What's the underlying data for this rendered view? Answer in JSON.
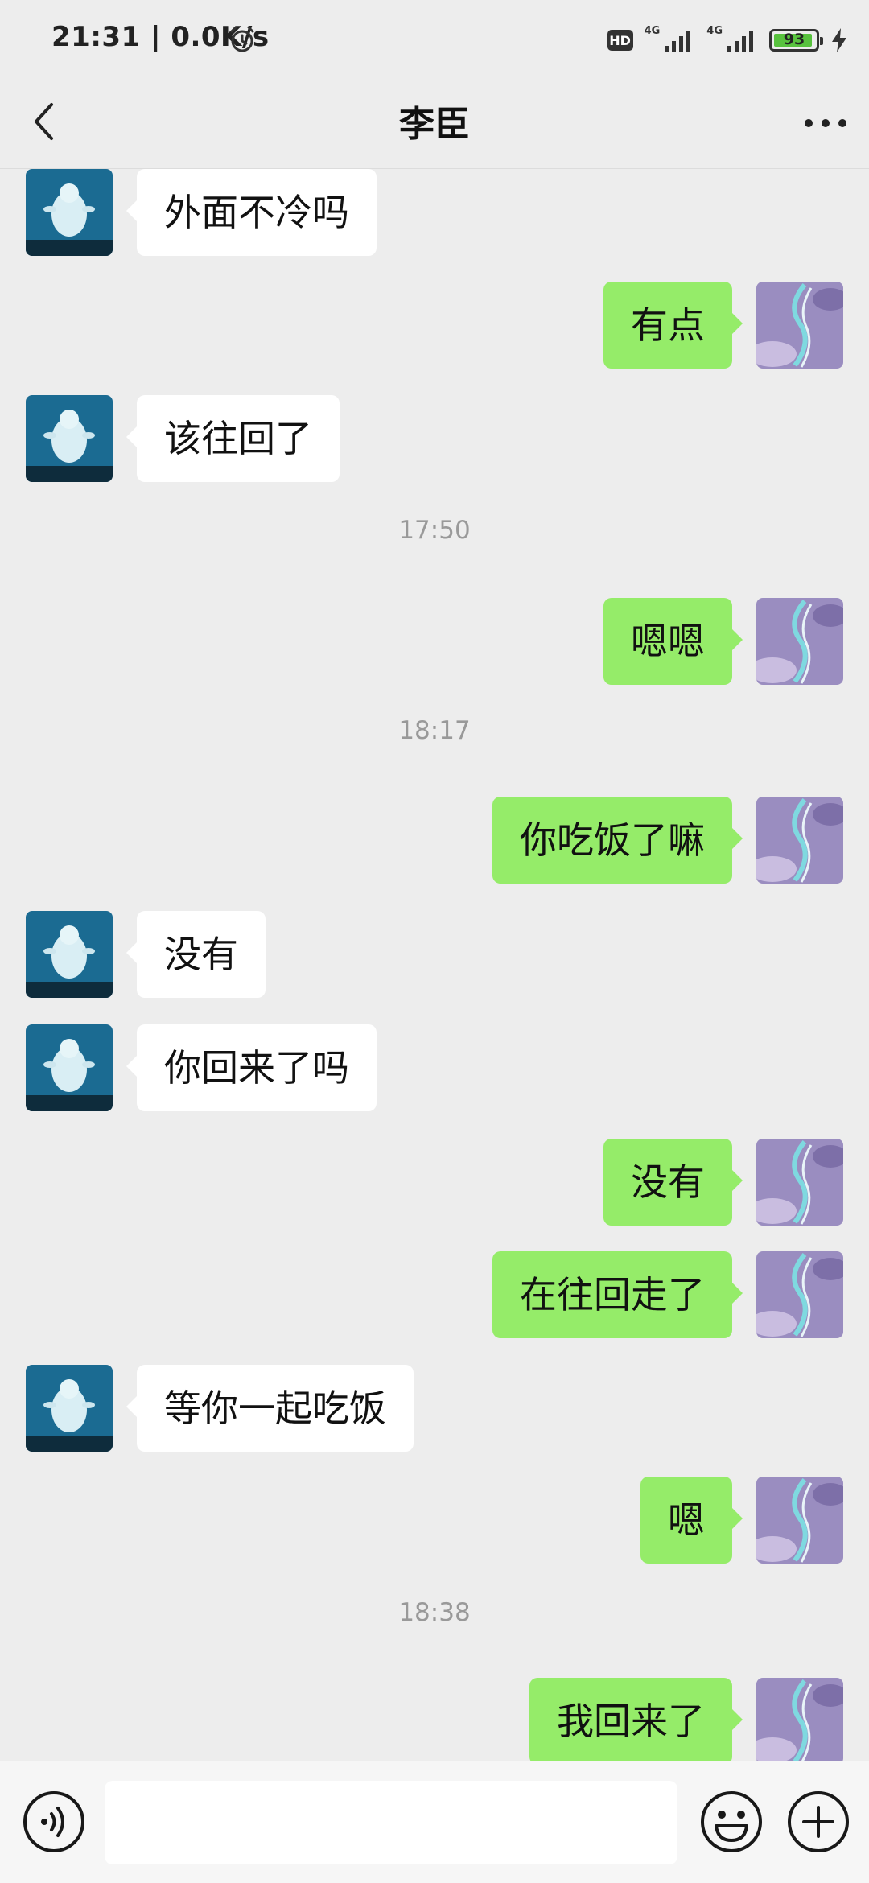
{
  "status_bar": {
    "time": "21:31 | 0.0K/s",
    "hd": "HD",
    "network_1": "4G",
    "network_2": "4G",
    "battery": "93",
    "battery_level": 0.93,
    "icons": [
      "alarm-icon",
      "signal-icon",
      "battery-icon",
      "charging-icon"
    ]
  },
  "header": {
    "title": "李臣",
    "icons": [
      "back-arrow-icon",
      "more-dots-icon"
    ]
  },
  "colors": {
    "background": "#ededed",
    "outgoing_bubble": "#95ec69",
    "incoming_bubble": "#ffffff",
    "timestamp": "#999999"
  },
  "messages": [
    {
      "type": "in",
      "text": "外面不冷吗"
    },
    {
      "type": "out",
      "text": "有点"
    },
    {
      "type": "in",
      "text": "该往回了"
    },
    {
      "type": "time",
      "text": "17:50"
    },
    {
      "type": "out",
      "text": "嗯嗯"
    },
    {
      "type": "time",
      "text": "18:17"
    },
    {
      "type": "out",
      "text": "你吃饭了嘛"
    },
    {
      "type": "in",
      "text": "没有"
    },
    {
      "type": "in",
      "text": "你回来了吗"
    },
    {
      "type": "out",
      "text": "没有"
    },
    {
      "type": "out",
      "text": "在往回走了"
    },
    {
      "type": "in",
      "text": "等你一起吃饭"
    },
    {
      "type": "out",
      "text": "嗯"
    },
    {
      "type": "time",
      "text": "18:38"
    },
    {
      "type": "out",
      "text": "我回来了"
    }
  ],
  "input_bar": {
    "value": "",
    "icons": [
      "voice-icon",
      "emoji-icon",
      "plus-icon"
    ]
  }
}
